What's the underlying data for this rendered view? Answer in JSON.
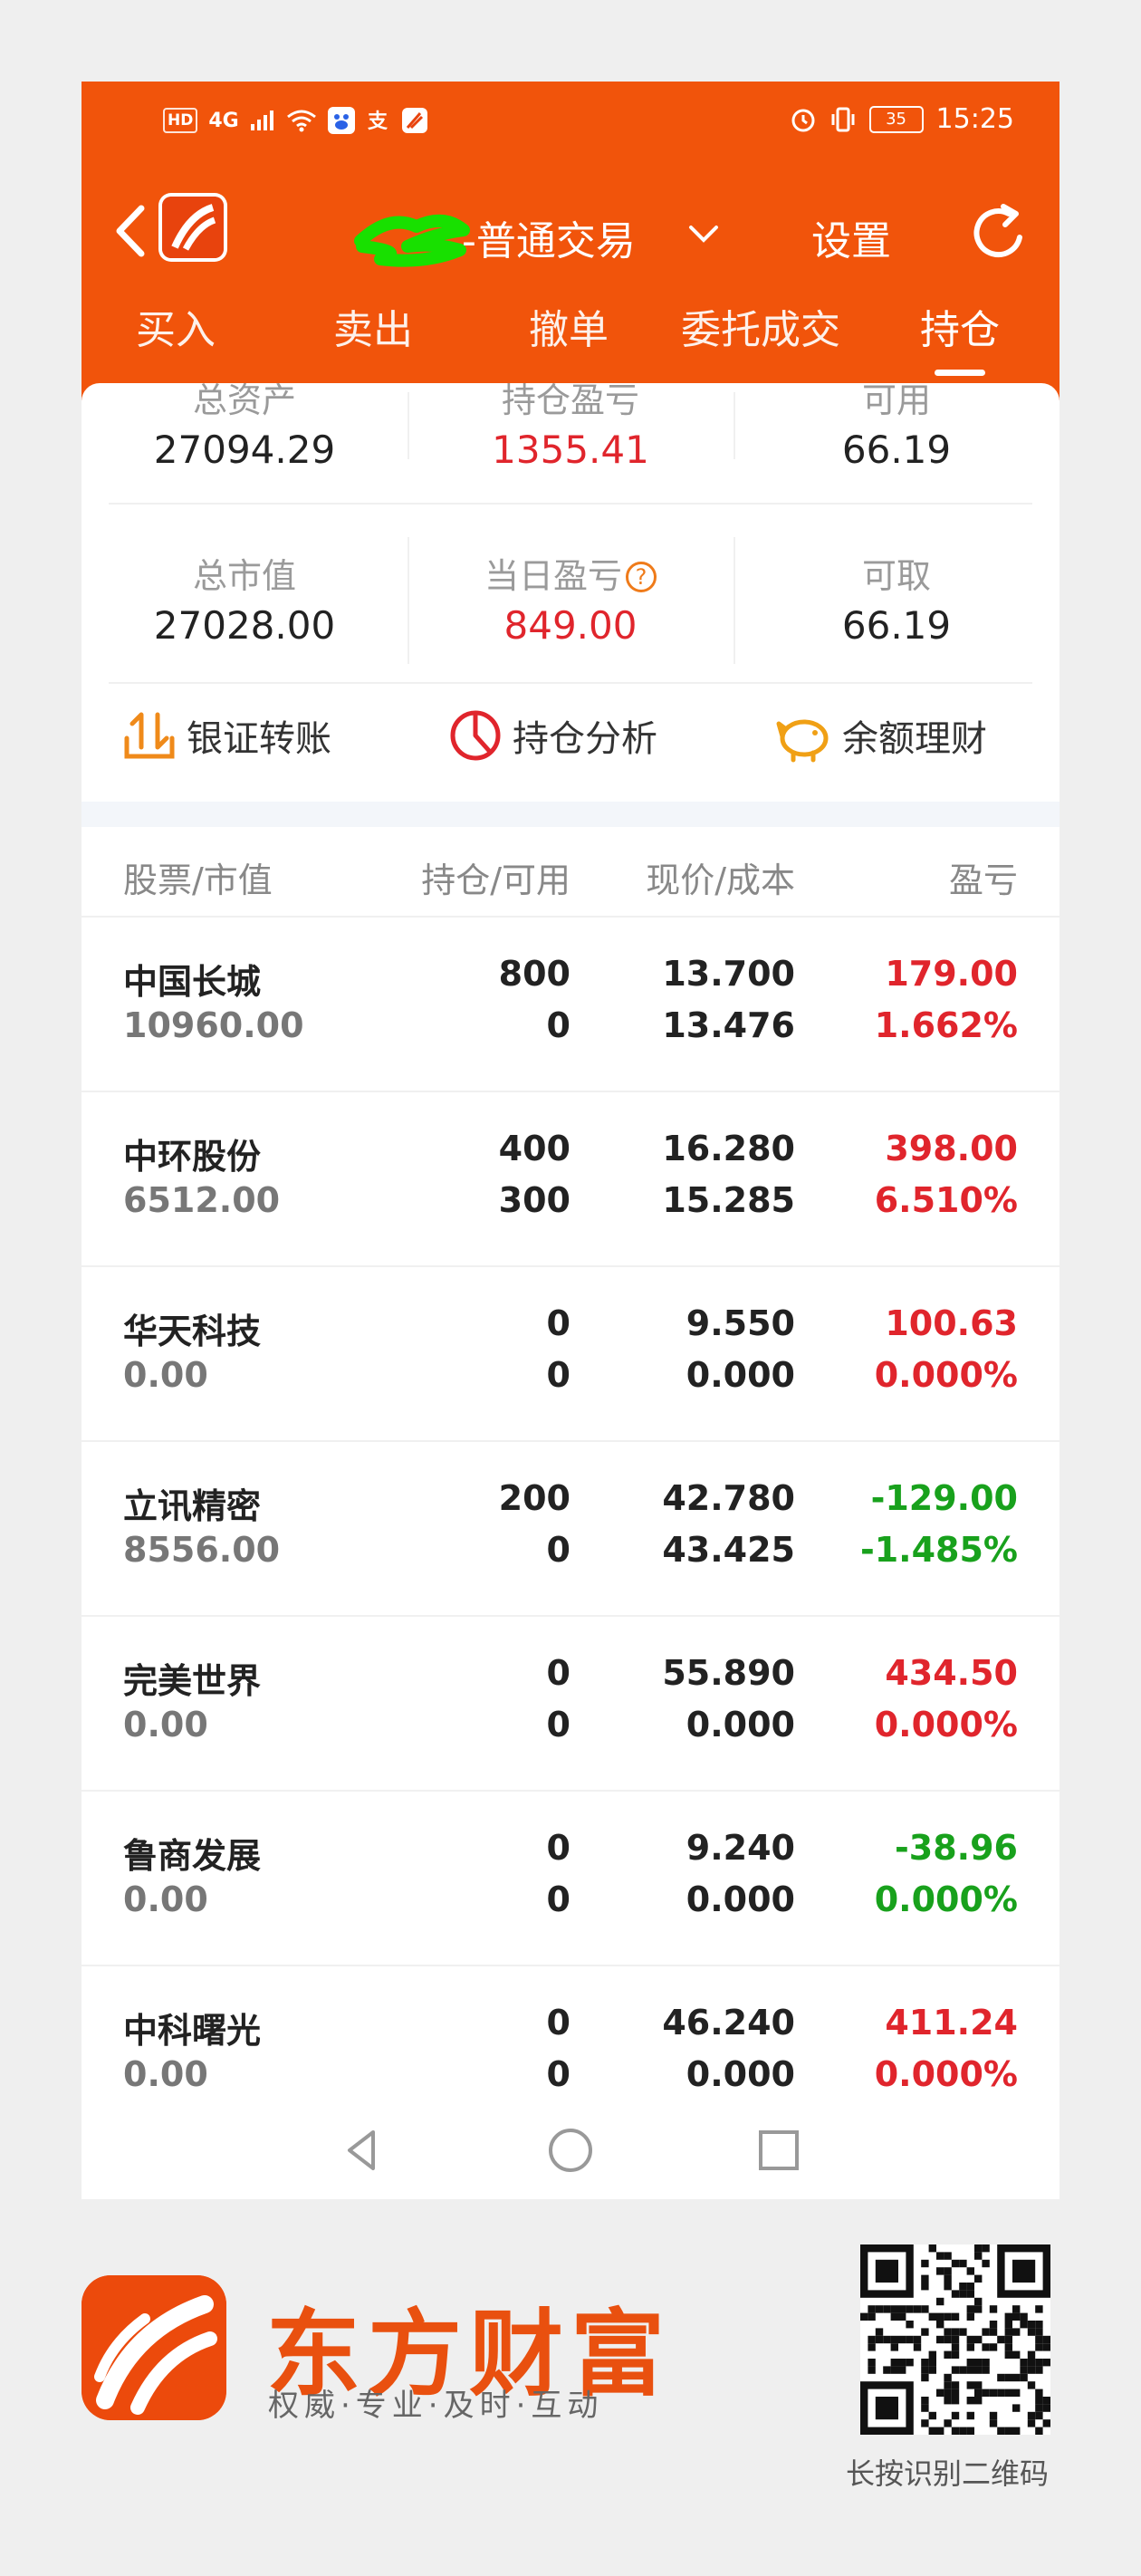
{
  "status_bar": {
    "left_icons": [
      "HD",
      "4G",
      "signal-icon",
      "wifi-icon",
      "baidu-icon",
      "alipay-icon",
      "app-icon"
    ],
    "hd_label": "HD",
    "net_label": "4G",
    "battery": "35",
    "time": "15:25"
  },
  "header": {
    "title_suffix": "-普通交易",
    "settings_label": "设置"
  },
  "tabs": [
    {
      "label": "买入"
    },
    {
      "label": "卖出"
    },
    {
      "label": "撤单"
    },
    {
      "label": "委托成交"
    },
    {
      "label": "持仓",
      "active": true
    }
  ],
  "summary": {
    "total_assets": {
      "label": "总资产",
      "value": "27094.29"
    },
    "position_pl": {
      "label": "持仓盈亏",
      "value": "1355.41"
    },
    "available": {
      "label": "可用",
      "value": "66.19"
    },
    "market_value": {
      "label": "总市值",
      "value": "27028.00"
    },
    "daily_pl": {
      "label": "当日盈亏",
      "value": "849.00"
    },
    "withdrawable": {
      "label": "可取",
      "value": "66.19"
    }
  },
  "actions": {
    "transfer": "银证转账",
    "analysis": "持仓分析",
    "wealth": "余额理财"
  },
  "table": {
    "headers": [
      "股票/市值",
      "持仓/可用",
      "现价/成本",
      "盈亏"
    ],
    "rows": [
      {
        "name": "中国长城",
        "market_value": "10960.00",
        "holding": "800",
        "available": "0",
        "price": "13.700",
        "cost": "13.476",
        "pl": "179.00",
        "pl_pct": "1.662%",
        "trend": "up"
      },
      {
        "name": "中环股份",
        "market_value": "6512.00",
        "holding": "400",
        "available": "300",
        "price": "16.280",
        "cost": "15.285",
        "pl": "398.00",
        "pl_pct": "6.510%",
        "trend": "up"
      },
      {
        "name": "华天科技",
        "market_value": "0.00",
        "holding": "0",
        "available": "0",
        "price": "9.550",
        "cost": "0.000",
        "pl": "100.63",
        "pl_pct": "0.000%",
        "trend": "up"
      },
      {
        "name": "立讯精密",
        "market_value": "8556.00",
        "holding": "200",
        "available": "0",
        "price": "42.780",
        "cost": "43.425",
        "pl": "-129.00",
        "pl_pct": "-1.485%",
        "trend": "down"
      },
      {
        "name": "完美世界",
        "market_value": "0.00",
        "holding": "0",
        "available": "0",
        "price": "55.890",
        "cost": "0.000",
        "pl": "434.50",
        "pl_pct": "0.000%",
        "trend": "up"
      },
      {
        "name": "鲁商发展",
        "market_value": "0.00",
        "holding": "0",
        "available": "0",
        "price": "9.240",
        "cost": "0.000",
        "pl": "-38.96",
        "pl_pct": "0.000%",
        "trend": "down"
      },
      {
        "name": "中科曙光",
        "market_value": "0.00",
        "holding": "0",
        "available": "0",
        "price": "46.240",
        "cost": "0.000",
        "pl": "411.24",
        "pl_pct": "0.000%",
        "trend": "up"
      }
    ]
  },
  "footer": {
    "brand_name": "东方财富",
    "slogan": "权威·专业·及时·互动",
    "qr_caption": "长按识别二维码"
  },
  "colors": {
    "brand_orange": "#f1540b",
    "gain_red": "#e0252c",
    "loss_green": "#18a11c"
  }
}
